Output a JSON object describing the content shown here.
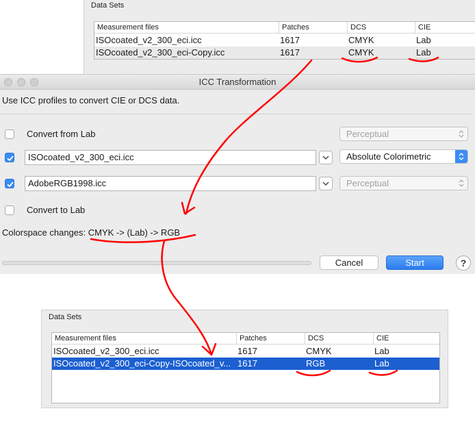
{
  "top_data_sets": {
    "title": "Data Sets",
    "columns": [
      "Measurement files",
      "Patches",
      "DCS",
      "CIE"
    ],
    "rows": [
      {
        "file": "ISOcoated_v2_300_eci.icc",
        "patches": "1617",
        "dcs": "CMYK",
        "cie": "Lab"
      },
      {
        "file": "ISOcoated_v2_300_eci-Copy.icc",
        "patches": "1617",
        "dcs": "CMYK",
        "cie": "Lab"
      }
    ]
  },
  "dialog": {
    "title": "ICC Transformation",
    "intro": "Use ICC profiles to convert CIE or DCS data.",
    "convert_from_lab": {
      "label": "Convert from Lab",
      "checked": false,
      "intent": "Perceptual"
    },
    "profile1": {
      "value": "ISOcoated_v2_300_eci.icc",
      "checked": true,
      "intent": "Absolute Colorimetric"
    },
    "profile2": {
      "value": "AdobeRGB1998.icc",
      "checked": true,
      "intent": "Perceptual"
    },
    "convert_to_lab": {
      "label": "Convert to Lab",
      "checked": false
    },
    "colorspace_changes": "Colorspace changes: CMYK -> (Lab) -> RGB",
    "cancel_label": "Cancel",
    "start_label": "Start",
    "help_label": "?"
  },
  "bottom_data_sets": {
    "title": "Data Sets",
    "columns": [
      "Measurement files",
      "Patches",
      "DCS",
      "CIE"
    ],
    "rows": [
      {
        "file": "ISOcoated_v2_300_eci.icc",
        "patches": "1617",
        "dcs": "CMYK",
        "cie": "Lab"
      },
      {
        "file": "ISOcoated_v2_300_eci-Copy-ISOcoated_v...",
        "patches": "1617",
        "dcs": "RGB",
        "cie": "Lab"
      }
    ],
    "selected_row": 1
  },
  "colors": {
    "accent": "#3b8cf3",
    "selection": "#1b5fd1",
    "annotation": "#ff0000"
  }
}
